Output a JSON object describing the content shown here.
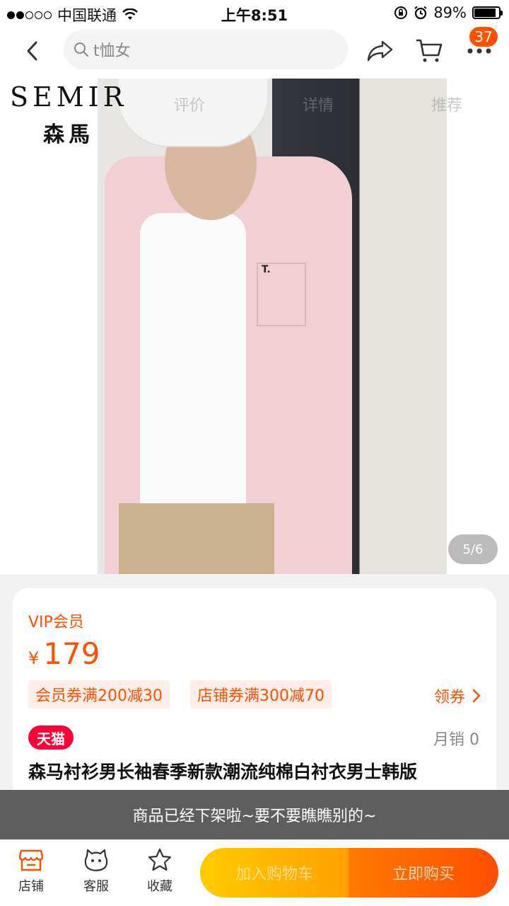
{
  "status_bar": {
    "carrier": "中国联通",
    "time": "上午8:51",
    "battery": "89%",
    "battery_level": 0.89
  },
  "nav": {
    "search_text": "t恤女",
    "cart_badge": "37"
  },
  "hero": {
    "brand_en": "SEMIR",
    "brand_cn": "森馬",
    "ghost_tabs": [
      "评价",
      "详情",
      "推荐"
    ],
    "pocket_letter": "T.",
    "pager": "5/6"
  },
  "product": {
    "vip_label": "VIP会员",
    "currency": "¥",
    "price": "179",
    "coupons": [
      "会员券满200减30",
      "店铺券满300减70"
    ],
    "claim_label": "领券",
    "tmall_tag": "天猫",
    "monthly_sales": "月销 0",
    "title": "森马衬衫男长袖春季新款潮流纯棉白衬衣男士韩版"
  },
  "toast": "商品已经下架啦~要不要瞧瞧别的~",
  "bottom_bar": {
    "tools": [
      "店铺",
      "客服",
      "收藏"
    ],
    "add_to_cart": "加入购物车",
    "buy_now": "立即购买"
  },
  "colors": {
    "accent": "#ff5000",
    "tmall_red": "#ff0036"
  }
}
